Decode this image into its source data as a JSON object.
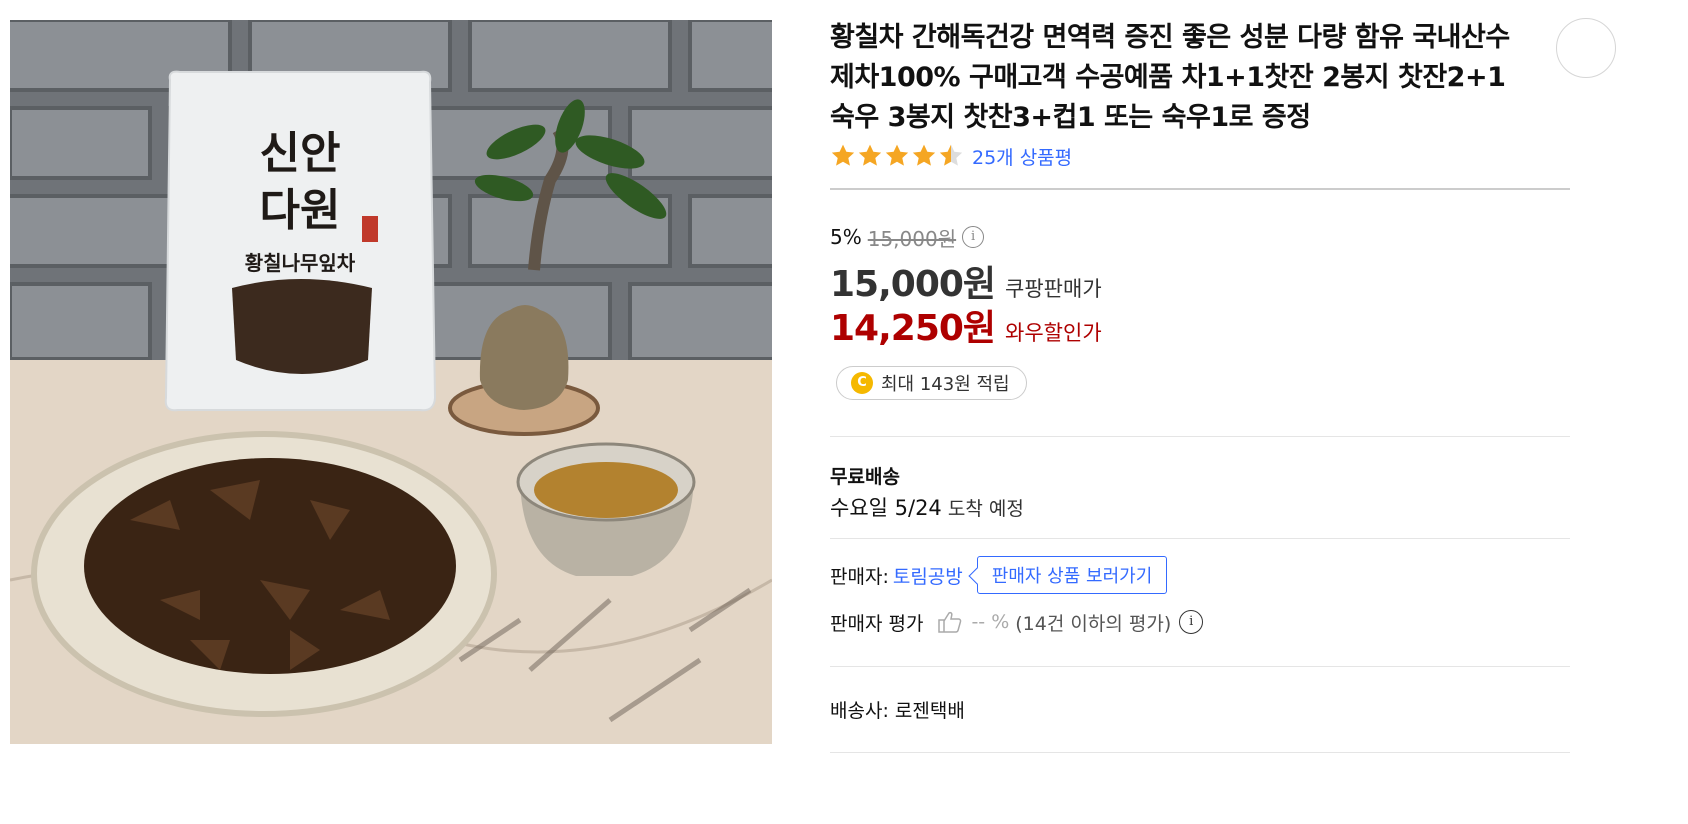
{
  "product": {
    "title": "황칠차 간해독건강 면역력 증진 좋은 성분 다량 함유 국내산수제차100% 구매고객 수공예품 차1+1찻잔 2봉지 찻잔2+1숙우 3봉지 찻찬3+컵1 또는 숙우1로 증정",
    "image_package_text": [
      "신안",
      "다원",
      "황칠나무잎차"
    ],
    "rating": {
      "stars": 4.5,
      "max_stars": 5,
      "review_count_label": "25개 상품평"
    },
    "price": {
      "discount_rate": "5%",
      "original_price": "15,000원",
      "info_icon": "i",
      "sale_price": "15,000원",
      "sale_label": "쿠팡판매가",
      "wow_price": "14,250원",
      "wow_label": "와우할인가"
    },
    "cash_reward": {
      "icon_letter": "C",
      "label": "최대 143원 적립"
    },
    "shipping": {
      "free_label": "무료배송",
      "arrival_date": "수요일 5/24",
      "arrival_suffix": " 도착 예정"
    },
    "seller": {
      "label": "판매자:",
      "name": "토림공방",
      "view_products_button": "판매자 상품 보러가기",
      "rating_label": "판매자 평가",
      "rating_percent": "-- %",
      "rating_note": "(14건 이하의 평가)",
      "info_icon": "i"
    },
    "carrier": "배송사: 로젠택배"
  },
  "colors": {
    "link_blue": "#346aff",
    "wow_red": "#ae0000",
    "star_orange": "#f5a623",
    "coin_yellow": "#f5b800"
  },
  "icons": {
    "star": "star-icon",
    "coin": "coin-icon",
    "thumbs_up": "thumbs-up-icon",
    "info": "info-icon"
  }
}
